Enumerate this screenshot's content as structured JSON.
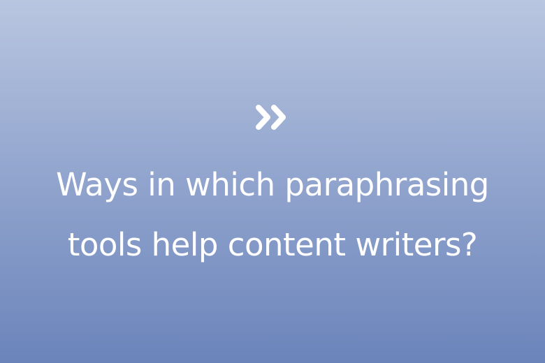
{
  "hero": {
    "icon": "double-chevron-right-icon",
    "title_lines": [
      "Ways in which paraphrasing",
      "tools help content writers?"
    ]
  },
  "colors": {
    "background_top": "#b9c6e0",
    "background_bottom": "#6b84ba",
    "text": "#ffffff"
  }
}
